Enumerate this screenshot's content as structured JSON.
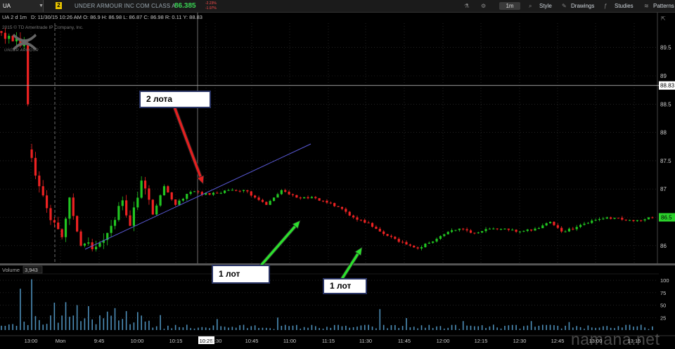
{
  "toolbar": {
    "symbol": "UA",
    "link_badge": "2",
    "description": "UNDER ARMOUR INC COM CLASS A",
    "last_price": "86.385",
    "change": "-2.23%",
    "change_value": "-1.97%",
    "timeframe": "1m",
    "style_label": "Style",
    "drawings_label": "Drawings",
    "studies_label": "Studies",
    "patterns_label": "Patterns",
    "icons": [
      "flask-icon",
      "gear-icon",
      "search-icon",
      "pencil-icon",
      "studies-icon",
      "patterns-icon"
    ]
  },
  "info_bar": {
    "title": "UA 2 d 1m",
    "ohlc": "D: 11/30/15 10:26 AM   O: 86.9   H: 86.98   L: 86.87   C: 86.98   R: 0.11   Y: 88.83"
  },
  "copyright": "2015 © TD Ameritrade IP Company, Inc.",
  "logo_text": "UNDER ARMOUR",
  "colors": {
    "up": "#21c521",
    "down": "#ee2222",
    "background": "#000000",
    "grid": "#3a3a3a",
    "trendline": "#5a5ad8",
    "annotation_border": "#2a3566",
    "arrow_red": "#e32020",
    "arrow_green": "#2ddf2d"
  },
  "chart_data": {
    "type": "candlestick",
    "symbol": "UA",
    "interval": "1m",
    "y_ticks": [
      "89.5",
      "89",
      "88.5",
      "88",
      "87.5",
      "87",
      "86.5",
      "86"
    ],
    "ylim": [
      85.75,
      90.25
    ],
    "price_line_label": "88.83",
    "price_line_value": 88.83,
    "last_label": "86.5",
    "last_value": 86.5,
    "x_ticks": [
      "13:00",
      "Mon",
      "9:45",
      "10:00",
      "10:15",
      "10:26",
      "10:30",
      "10:45",
      "11:00",
      "11:15",
      "11:30",
      "11:45",
      "12:00",
      "12:15",
      "12:30",
      "12:45",
      "13:00",
      "13:15"
    ],
    "crosshair_label": "10:26",
    "volume_label": "Volume",
    "volume_value": "3,943",
    "volume_ticks": [
      "100",
      "75",
      "50",
      "25"
    ],
    "volume_ylim": [
      0,
      110
    ],
    "anchors": [
      {
        "i": 0,
        "c": 89.76
      },
      {
        "i": 3,
        "c": 89.61
      },
      {
        "i": 6,
        "c": 89.58
      },
      {
        "i": 8,
        "c": 87.55
      },
      {
        "i": 10,
        "c": 87.05
      },
      {
        "i": 13,
        "c": 86.45
      },
      {
        "i": 16,
        "c": 86.15
      },
      {
        "i": 18,
        "c": 86.85
      },
      {
        "i": 21,
        "c": 86.0
      },
      {
        "i": 25,
        "c": 85.98
      },
      {
        "i": 29,
        "c": 86.35
      },
      {
        "i": 32,
        "c": 86.8
      },
      {
        "i": 34,
        "c": 86.35
      },
      {
        "i": 37,
        "c": 87.15
      },
      {
        "i": 40,
        "c": 86.55
      },
      {
        "i": 43,
        "c": 87.05
      },
      {
        "i": 46,
        "c": 86.72
      },
      {
        "i": 50,
        "c": 86.95
      },
      {
        "i": 55,
        "c": 86.9
      },
      {
        "i": 60,
        "c": 86.98
      },
      {
        "i": 64,
        "c": 86.98
      },
      {
        "i": 67,
        "c": 86.85
      },
      {
        "i": 70,
        "c": 86.72
      },
      {
        "i": 74,
        "c": 86.98
      },
      {
        "i": 78,
        "c": 86.85
      },
      {
        "i": 82,
        "c": 86.86
      },
      {
        "i": 86,
        "c": 86.76
      },
      {
        "i": 90,
        "c": 86.65
      },
      {
        "i": 93,
        "c": 86.5
      },
      {
        "i": 97,
        "c": 86.4
      },
      {
        "i": 100,
        "c": 86.25
      },
      {
        "i": 104,
        "c": 86.12
      },
      {
        "i": 107,
        "c": 86.02
      },
      {
        "i": 110,
        "c": 85.95
      },
      {
        "i": 113,
        "c": 86.05
      },
      {
        "i": 117,
        "c": 86.2
      },
      {
        "i": 121,
        "c": 86.3
      },
      {
        "i": 125,
        "c": 86.22
      },
      {
        "i": 129,
        "c": 86.3
      },
      {
        "i": 133,
        "c": 86.3
      },
      {
        "i": 137,
        "c": 86.25
      },
      {
        "i": 141,
        "c": 86.3
      },
      {
        "i": 145,
        "c": 86.42
      },
      {
        "i": 148,
        "c": 86.25
      },
      {
        "i": 152,
        "c": 86.33
      },
      {
        "i": 155,
        "c": 86.4
      },
      {
        "i": 158,
        "c": 86.47
      },
      {
        "i": 160,
        "c": 86.5
      },
      {
        "i": 164,
        "c": 86.46
      },
      {
        "i": 168,
        "c": 86.45
      },
      {
        "i": 172,
        "c": 86.5
      }
    ],
    "bar_count": 173,
    "annotations": [
      {
        "text": "2 лота"
      },
      {
        "text": "1 лот"
      },
      {
        "text": "1 лот"
      }
    ]
  },
  "watermark": "namana.net"
}
